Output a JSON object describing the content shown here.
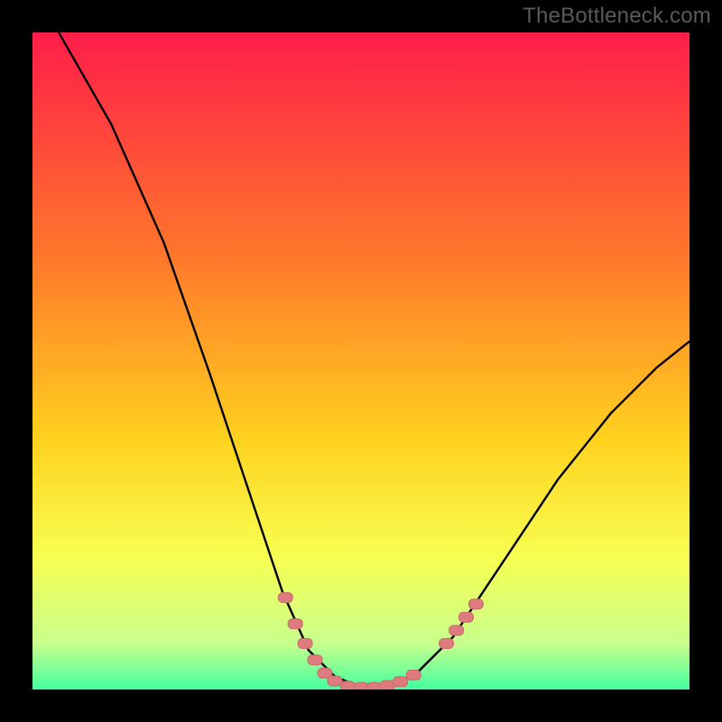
{
  "watermark": "TheBottleneck.com",
  "colors": {
    "frame_bg": "#000000",
    "gradient_top": "#ff1d49",
    "gradient_mid1": "#ff7a2a",
    "gradient_mid2": "#ffd21f",
    "gradient_mid3": "#f7ff52",
    "gradient_bottom1": "#c8ff8d",
    "gradient_bottom2": "#43ff9e",
    "curve": "#000000",
    "marker_fill": "#dd7b7f",
    "marker_stroke": "#c96a6e"
  },
  "chart_data": {
    "type": "line",
    "title": "",
    "xlabel": "",
    "ylabel": "",
    "xlim": [
      0,
      100
    ],
    "ylim": [
      0,
      100
    ],
    "curve_segments": [
      {
        "name": "left-descent",
        "points": [
          [
            4,
            100
          ],
          [
            12,
            86
          ],
          [
            20,
            68
          ],
          [
            27,
            48
          ],
          [
            33,
            30
          ],
          [
            38,
            15
          ],
          [
            42,
            6
          ],
          [
            46,
            2
          ],
          [
            50,
            0.3
          ]
        ]
      },
      {
        "name": "right-ascent",
        "points": [
          [
            53,
            0.3
          ],
          [
            58,
            2
          ],
          [
            64,
            8
          ],
          [
            72,
            20
          ],
          [
            80,
            32
          ],
          [
            88,
            42
          ],
          [
            95,
            49
          ],
          [
            100,
            53
          ]
        ]
      }
    ],
    "markers": [
      {
        "x": 38.5,
        "y": 14
      },
      {
        "x": 40.0,
        "y": 10
      },
      {
        "x": 41.5,
        "y": 7
      },
      {
        "x": 43.0,
        "y": 4.5
      },
      {
        "x": 44.5,
        "y": 2.5
      },
      {
        "x": 46.0,
        "y": 1.3
      },
      {
        "x": 48.0,
        "y": 0.5
      },
      {
        "x": 50.0,
        "y": 0.3
      },
      {
        "x": 52.0,
        "y": 0.3
      },
      {
        "x": 54.0,
        "y": 0.6
      },
      {
        "x": 56.0,
        "y": 1.2
      },
      {
        "x": 58.0,
        "y": 2.2
      },
      {
        "x": 63.0,
        "y": 7
      },
      {
        "x": 64.5,
        "y": 9
      },
      {
        "x": 66.0,
        "y": 11
      },
      {
        "x": 67.5,
        "y": 13
      }
    ],
    "gradient_stops": [
      {
        "offset": 0.0,
        "color_key": "gradient_top"
      },
      {
        "offset": 0.35,
        "color_key": "gradient_mid1"
      },
      {
        "offset": 0.62,
        "color_key": "gradient_mid2"
      },
      {
        "offset": 0.8,
        "color_key": "gradient_mid3"
      },
      {
        "offset": 0.93,
        "color_key": "gradient_bottom1"
      },
      {
        "offset": 1.0,
        "color_key": "gradient_bottom2"
      }
    ]
  }
}
